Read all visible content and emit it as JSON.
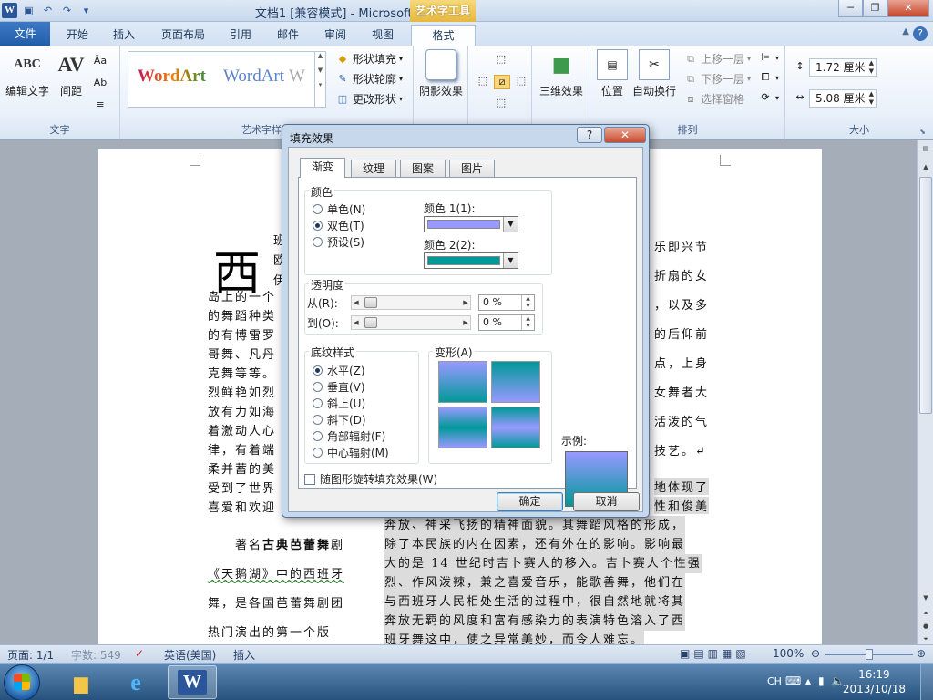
{
  "app": {
    "title": "文档1 [兼容模式] - Microsoft Word",
    "context_tab_header": "艺术字工具"
  },
  "tabs": [
    "文件",
    "开始",
    "插入",
    "页面布局",
    "引用",
    "邮件",
    "审阅",
    "视图",
    "格式"
  ],
  "ribbon": {
    "text_group": {
      "label": "文字",
      "edit_text": "编辑文字",
      "spacing": "间距"
    },
    "wordart_group": {
      "label": "艺术字样式",
      "sample1": "WordArt",
      "sample2": "WordArt",
      "sample3": "W",
      "shape_fill": "形状填充",
      "shape_outline": "形状轮廓",
      "change_shape": "更改形状"
    },
    "shadow_effects": "阴影效果",
    "threed_effects": "三维效果",
    "arrange_group": {
      "label": "排列",
      "position": "位置",
      "auto_wrap": "自动换行",
      "bring_forward": "上移一层",
      "send_backward": "下移一层",
      "selection_pane": "选择窗格"
    },
    "size_group": {
      "label": "大小",
      "height": "1.72 厘米",
      "width": "5.08 厘米"
    }
  },
  "document": {
    "drop_cap": "西",
    "left_lines": [
      "岛上的一个",
      "的舞蹈种类",
      "的有博雷罗",
      "哥舞、凡丹",
      "克舞等等。",
      "烈鲜艳如烈",
      "放有力如海",
      "着激动人心",
      "律，有着端",
      "柔并蓄的美",
      "受到了世界",
      "喜爱和欢迎"
    ],
    "top_frags": [
      "班",
      "欧",
      "伊"
    ],
    "right_lines": [
      "乐即兴节",
      "折扇的女",
      "，以及多",
      "的后仰前",
      "点，上身",
      "女舞者大",
      "活泼的气",
      "技艺。↵"
    ],
    "hl_right": [
      "地体现了",
      "性和俊美"
    ],
    "hl_lines": [
      "奔放、神采飞扬的精神面貌。其舞蹈风格的形成，",
      "除了本民族的内在因素，还有外在的影响。影响最",
      "大的是 14 世纪时吉卜赛人的移入。吉卜赛人个性强",
      "烈、作风泼辣，兼之喜爱音乐，能歌善舞，他们在",
      "与西班牙人民相处生活的过程中，很自然地就将其",
      "奔放无羁的风度和富有感染力的表演特色溶入了西",
      "班牙舞这中，使之异常美妙，而令人难忘。"
    ],
    "ballet_pre": "著名",
    "ballet_bold": "古典芭蕾舞",
    "ballet_post": "剧",
    "ballet_lines": [
      "《天鹅湖》中的西班牙",
      "舞，是各国芭蕾舞剧团",
      "热门演出的第一个版"
    ]
  },
  "statusbar": {
    "page": "页面: 1/1",
    "words": "字数: 549",
    "language": "英语(美国)",
    "mode": "插入",
    "zoom": "100%"
  },
  "taskbar": {
    "lang": "CH",
    "time": "16:19",
    "date": "2013/10/18"
  },
  "dialog": {
    "title": "填充效果",
    "tabs": [
      "渐变",
      "纹理",
      "图案",
      "图片"
    ],
    "colors_section": "颜色",
    "color_options": [
      "单色(N)",
      "双色(T)",
      "预设(S)"
    ],
    "color1_label": "颜色 1(1):",
    "color2_label": "颜色 2(2):",
    "color1_hex": "#9999ff",
    "color2_hex": "#009999",
    "transparency_section": "透明度",
    "from_label": "从(R):",
    "to_label": "到(O):",
    "from_value": "0 %",
    "to_value": "0 %",
    "shading_section": "底纹样式",
    "shading_options": [
      "水平(Z)",
      "垂直(V)",
      "斜上(U)",
      "斜下(D)",
      "角部辐射(F)",
      "中心辐射(M)"
    ],
    "variants_label": "变形(A)",
    "sample_label": "示例:",
    "rotate_checkbox": "随图形旋转填充效果(W)",
    "ok": "确定",
    "cancel": "取消"
  }
}
